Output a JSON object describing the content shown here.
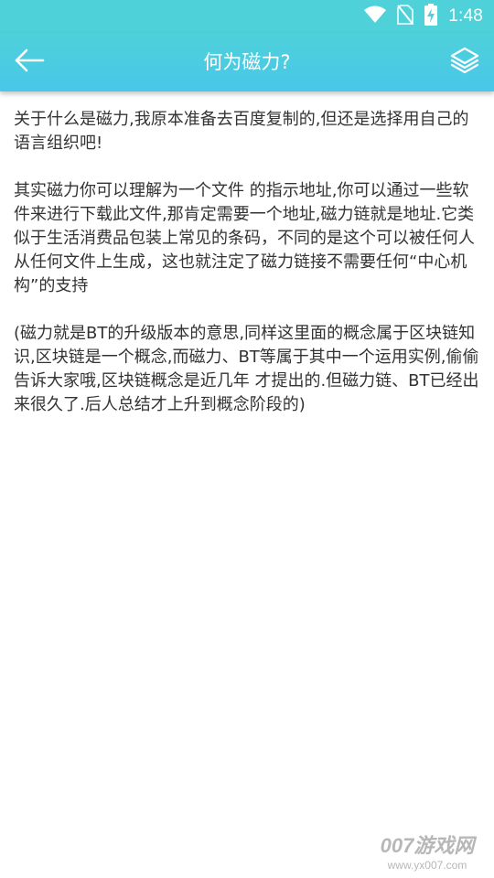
{
  "status_bar": {
    "time": "1:48",
    "icons": [
      "wifi-icon",
      "no-sim-icon",
      "battery-charging-icon"
    ]
  },
  "header": {
    "title": "何为磁力?",
    "back_icon": "back-arrow-icon",
    "action_icon": "layers-icon",
    "accent_color": "#4fd1da"
  },
  "content": {
    "paragraphs": [
      "关于什么是磁力,我原本准备去百度复制的,但还是选择用自己的语言组织吧!",
      "其实磁力你可以理解为一个文件 的指示地址,你可以通过一些软件来进行下载此文件,那肯定需要一个地址,磁力链就是地址.它类似于生活消费品包装上常见的条码，不同的是这个可以被任何人从任何文件上生成，这也就注定了磁力链接不需要任何“中心机构”的支持",
      "(磁力就是BT的升级版本的意思,同样这里面的概念属于区块链知识,区块链是一个概念,而磁力、BT等属于其中一个运用实例,偷偷告诉大家哦,区块链概念是近几年 才提出的.但磁力链、BT已经出来很久了.后人总结才上升到概念阶段的)"
    ]
  },
  "watermark": {
    "logo": "007游戏网",
    "url": "www.yx007.com"
  }
}
